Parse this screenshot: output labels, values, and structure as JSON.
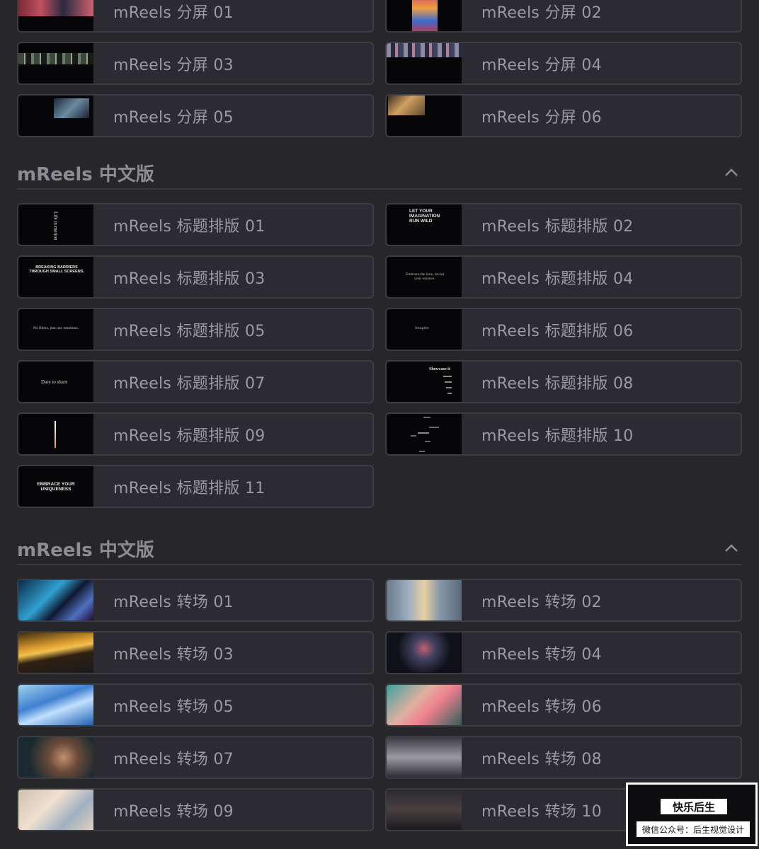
{
  "split_screen_items": [
    {
      "label": "mReels 分屏 01"
    },
    {
      "label": "mReels 分屏 02"
    },
    {
      "label": "mReels 分屏 03"
    },
    {
      "label": "mReels 分屏 04"
    },
    {
      "label": "mReels 分屏 05"
    },
    {
      "label": "mReels 分屏 06"
    }
  ],
  "section_title_typography": "mReels 中文版",
  "title_items": [
    {
      "label": "mReels 标题排版 01",
      "thumb_text": "Life in motion"
    },
    {
      "label": "mReels 标题排版 02",
      "thumb_text": "LET YOUR IMAGINATION RUN WILD"
    },
    {
      "label": "mReels 标题排版 03",
      "thumb_text": "BREAKING BARRIERS THROUGH SMALL SCREENS."
    },
    {
      "label": "mReels 标题排版 04",
      "thumb_text": "Embrace the lens, reveal your essence."
    },
    {
      "label": "mReels 标题排版 05",
      "thumb_text": "No filters, just raw emotions."
    },
    {
      "label": "mReels 标题排版 06",
      "thumb_text": "Imagine"
    },
    {
      "label": "mReels 标题排版 07",
      "thumb_text": "Dare to share"
    },
    {
      "label": "mReels 标题排版 08",
      "thumb_text": "Showcase it"
    },
    {
      "label": "mReels 标题排版 09",
      "thumb_text": ""
    },
    {
      "label": "mReels 标题排版 10",
      "thumb_text": ""
    },
    {
      "label": "mReels 标题排版 11",
      "thumb_text": "EMBRACE YOUR UNIQUENESS"
    }
  ],
  "section_title_transitions": "mReels 中文版",
  "transition_items": [
    {
      "label": "mReels 转场 01"
    },
    {
      "label": "mReels 转场 02"
    },
    {
      "label": "mReels 转场 03"
    },
    {
      "label": "mReels 转场 04"
    },
    {
      "label": "mReels 转场 05"
    },
    {
      "label": "mReels 转场 06"
    },
    {
      "label": "mReels 转场 07"
    },
    {
      "label": "mReels 转场 08"
    },
    {
      "label": "mReels 转场 09"
    },
    {
      "label": "mReels 转场 10"
    }
  ],
  "watermark": {
    "title": "快乐后生",
    "subtitle": "微信公众号：后生视觉设计"
  },
  "colors": {
    "background": "#26262b",
    "card": "#2b2b31",
    "card_border": "#3c3c43",
    "label_text": "#9a9aa0"
  }
}
